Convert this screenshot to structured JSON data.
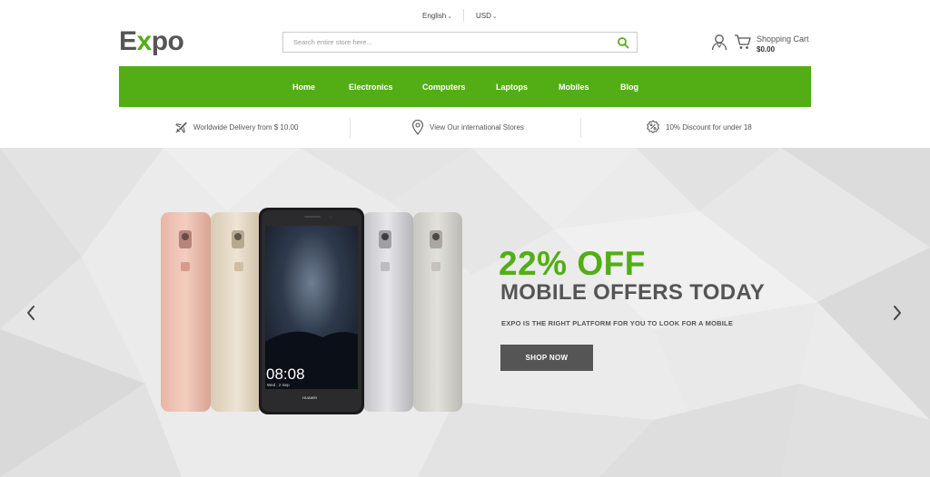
{
  "topbar": {
    "language": "English",
    "currency": "USD"
  },
  "logo": {
    "part1": "E",
    "part2": "x",
    "part3": "po"
  },
  "search": {
    "placeholder": "Search entire store here..."
  },
  "cart": {
    "label": "Shopping Cart",
    "amount": "$0.00"
  },
  "nav": {
    "items": [
      "Home",
      "Electronics",
      "Computers",
      "Laptops",
      "Mobiles",
      "Blog"
    ]
  },
  "features": [
    {
      "icon": "airplane-icon",
      "text": "Worldwide Delivery from $ 10.00"
    },
    {
      "icon": "map-pin-icon",
      "text": "View Our international Stores"
    },
    {
      "icon": "discount-badge-icon",
      "text": "10% Discount for under 18"
    }
  ],
  "hero": {
    "discount": "22% OFF",
    "title": "MOBILE OFFERS TODAY",
    "subtitle": "EXPO IS THE RIGHT PLATFORM FOR YOU TO LOOK FOR A MOBILE",
    "cta": "SHOP NOW",
    "phone_time": "08:08",
    "phone_date": "Wed , 2 Sep",
    "phone_brand": "HUAWEI"
  },
  "colors": {
    "accent": "#52ae14",
    "dark": "#555555"
  }
}
